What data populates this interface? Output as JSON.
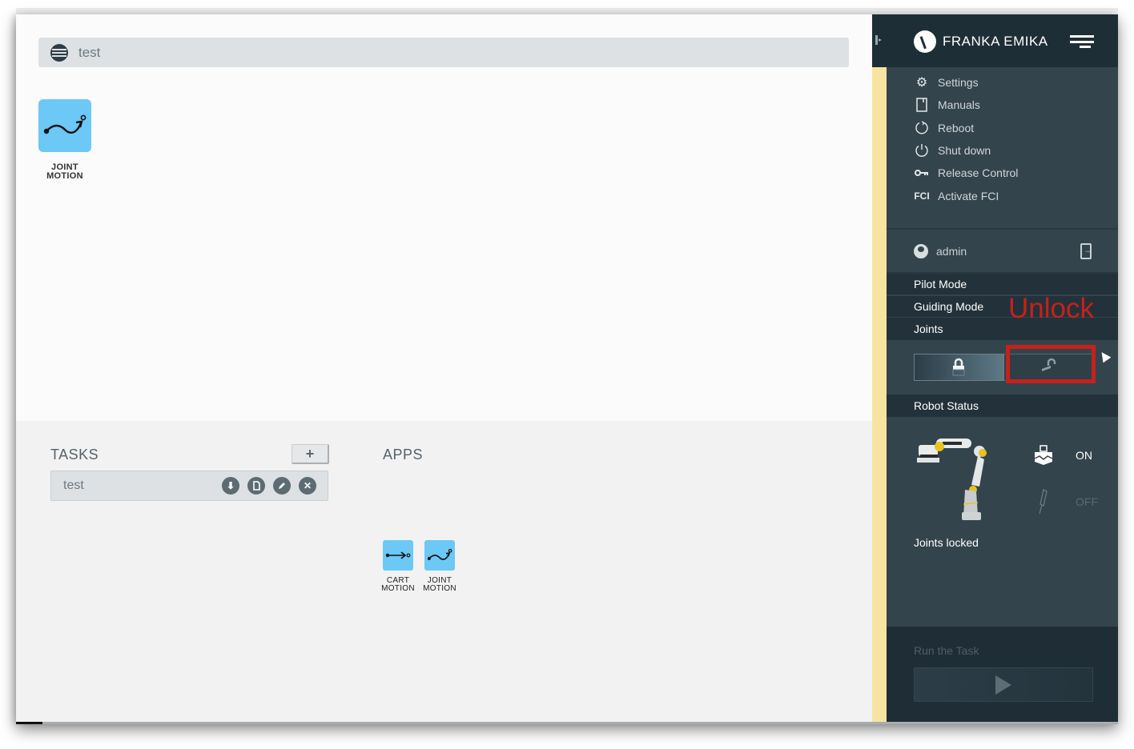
{
  "task_header": {
    "title": "test",
    "icon": "globe-icon"
  },
  "canvas": {
    "tiles": [
      {
        "label_line1": "JOINT",
        "label_line2": "MOTION",
        "icon": "joint-motion-icon"
      }
    ]
  },
  "tasks": {
    "heading": "TASKS",
    "add_label": "+",
    "items": [
      {
        "name": "test",
        "actions": [
          "download-icon",
          "copy-icon",
          "edit-icon",
          "delete-icon"
        ]
      }
    ]
  },
  "apps": {
    "heading": "APPS",
    "items": [
      {
        "label_line1": "CART",
        "label_line2": "MOTION",
        "icon": "cart-motion-icon"
      },
      {
        "label_line1": "JOINT",
        "label_line2": "MOTION",
        "icon": "joint-motion-icon"
      }
    ]
  },
  "sidebar": {
    "brand": "FRANKA EMIKA",
    "menu": [
      {
        "label": "Settings",
        "icon": "gear-icon"
      },
      {
        "label": "Manuals",
        "icon": "book-icon"
      },
      {
        "label": "Reboot",
        "icon": "reboot-icon"
      },
      {
        "label": "Shut down",
        "icon": "power-icon"
      },
      {
        "label": "Release Control",
        "icon": "key-icon"
      },
      {
        "label": "Activate FCI",
        "icon_text": "FCI"
      }
    ],
    "user": {
      "name": "admin"
    },
    "modes": [
      "Pilot Mode",
      "Guiding Mode",
      "Joints"
    ],
    "annotation": "Unlock",
    "robot_status": {
      "heading": "Robot Status",
      "gripper_state": "ON",
      "tool_state": "OFF",
      "joints_text": "Joints locked"
    },
    "run": {
      "label": "Run the Task"
    }
  },
  "colors": {
    "accent_tile": "#6cc8f5",
    "sidebar_bg": "#34444c",
    "annotation_red": "#c8201a",
    "strip_yellow": "#f6e4a0"
  }
}
